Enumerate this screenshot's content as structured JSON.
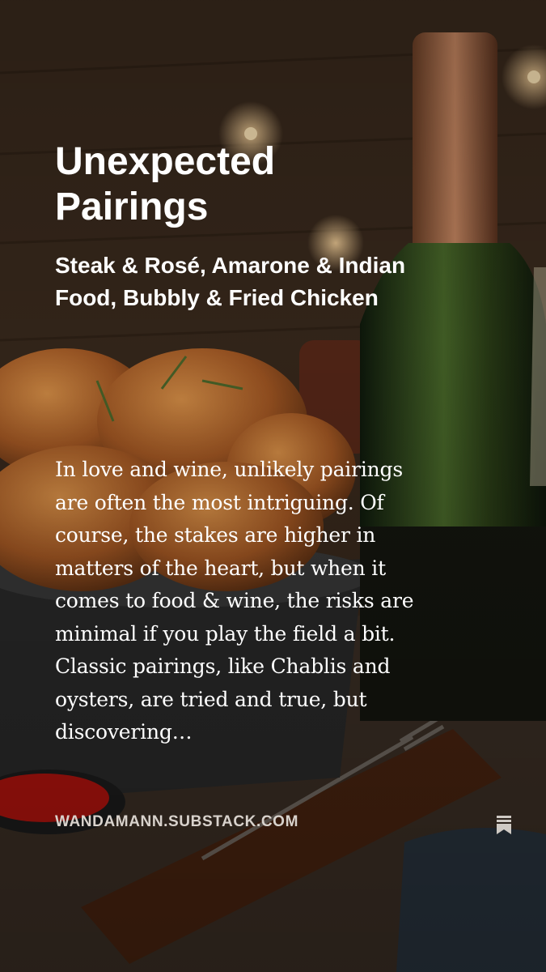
{
  "post": {
    "title": "Unexpected Pairings",
    "subtitle": "Steak & Rosé, Amarone & Indian Food, Bubbly & Fried Chicken",
    "excerpt": "In love and wine, unlikely pairings are often the most intriguing. Of course, the stakes are higher in matters of the heart, but when it comes to food & wine, the risks are minimal if you play the field a bit. Classic pairings, like Chablis and oysters, are tried and true, but discovering…",
    "source_domain": "WANDAMANN.SUBSTACK.COM"
  },
  "icons": {
    "save": "bookmark-icon"
  }
}
